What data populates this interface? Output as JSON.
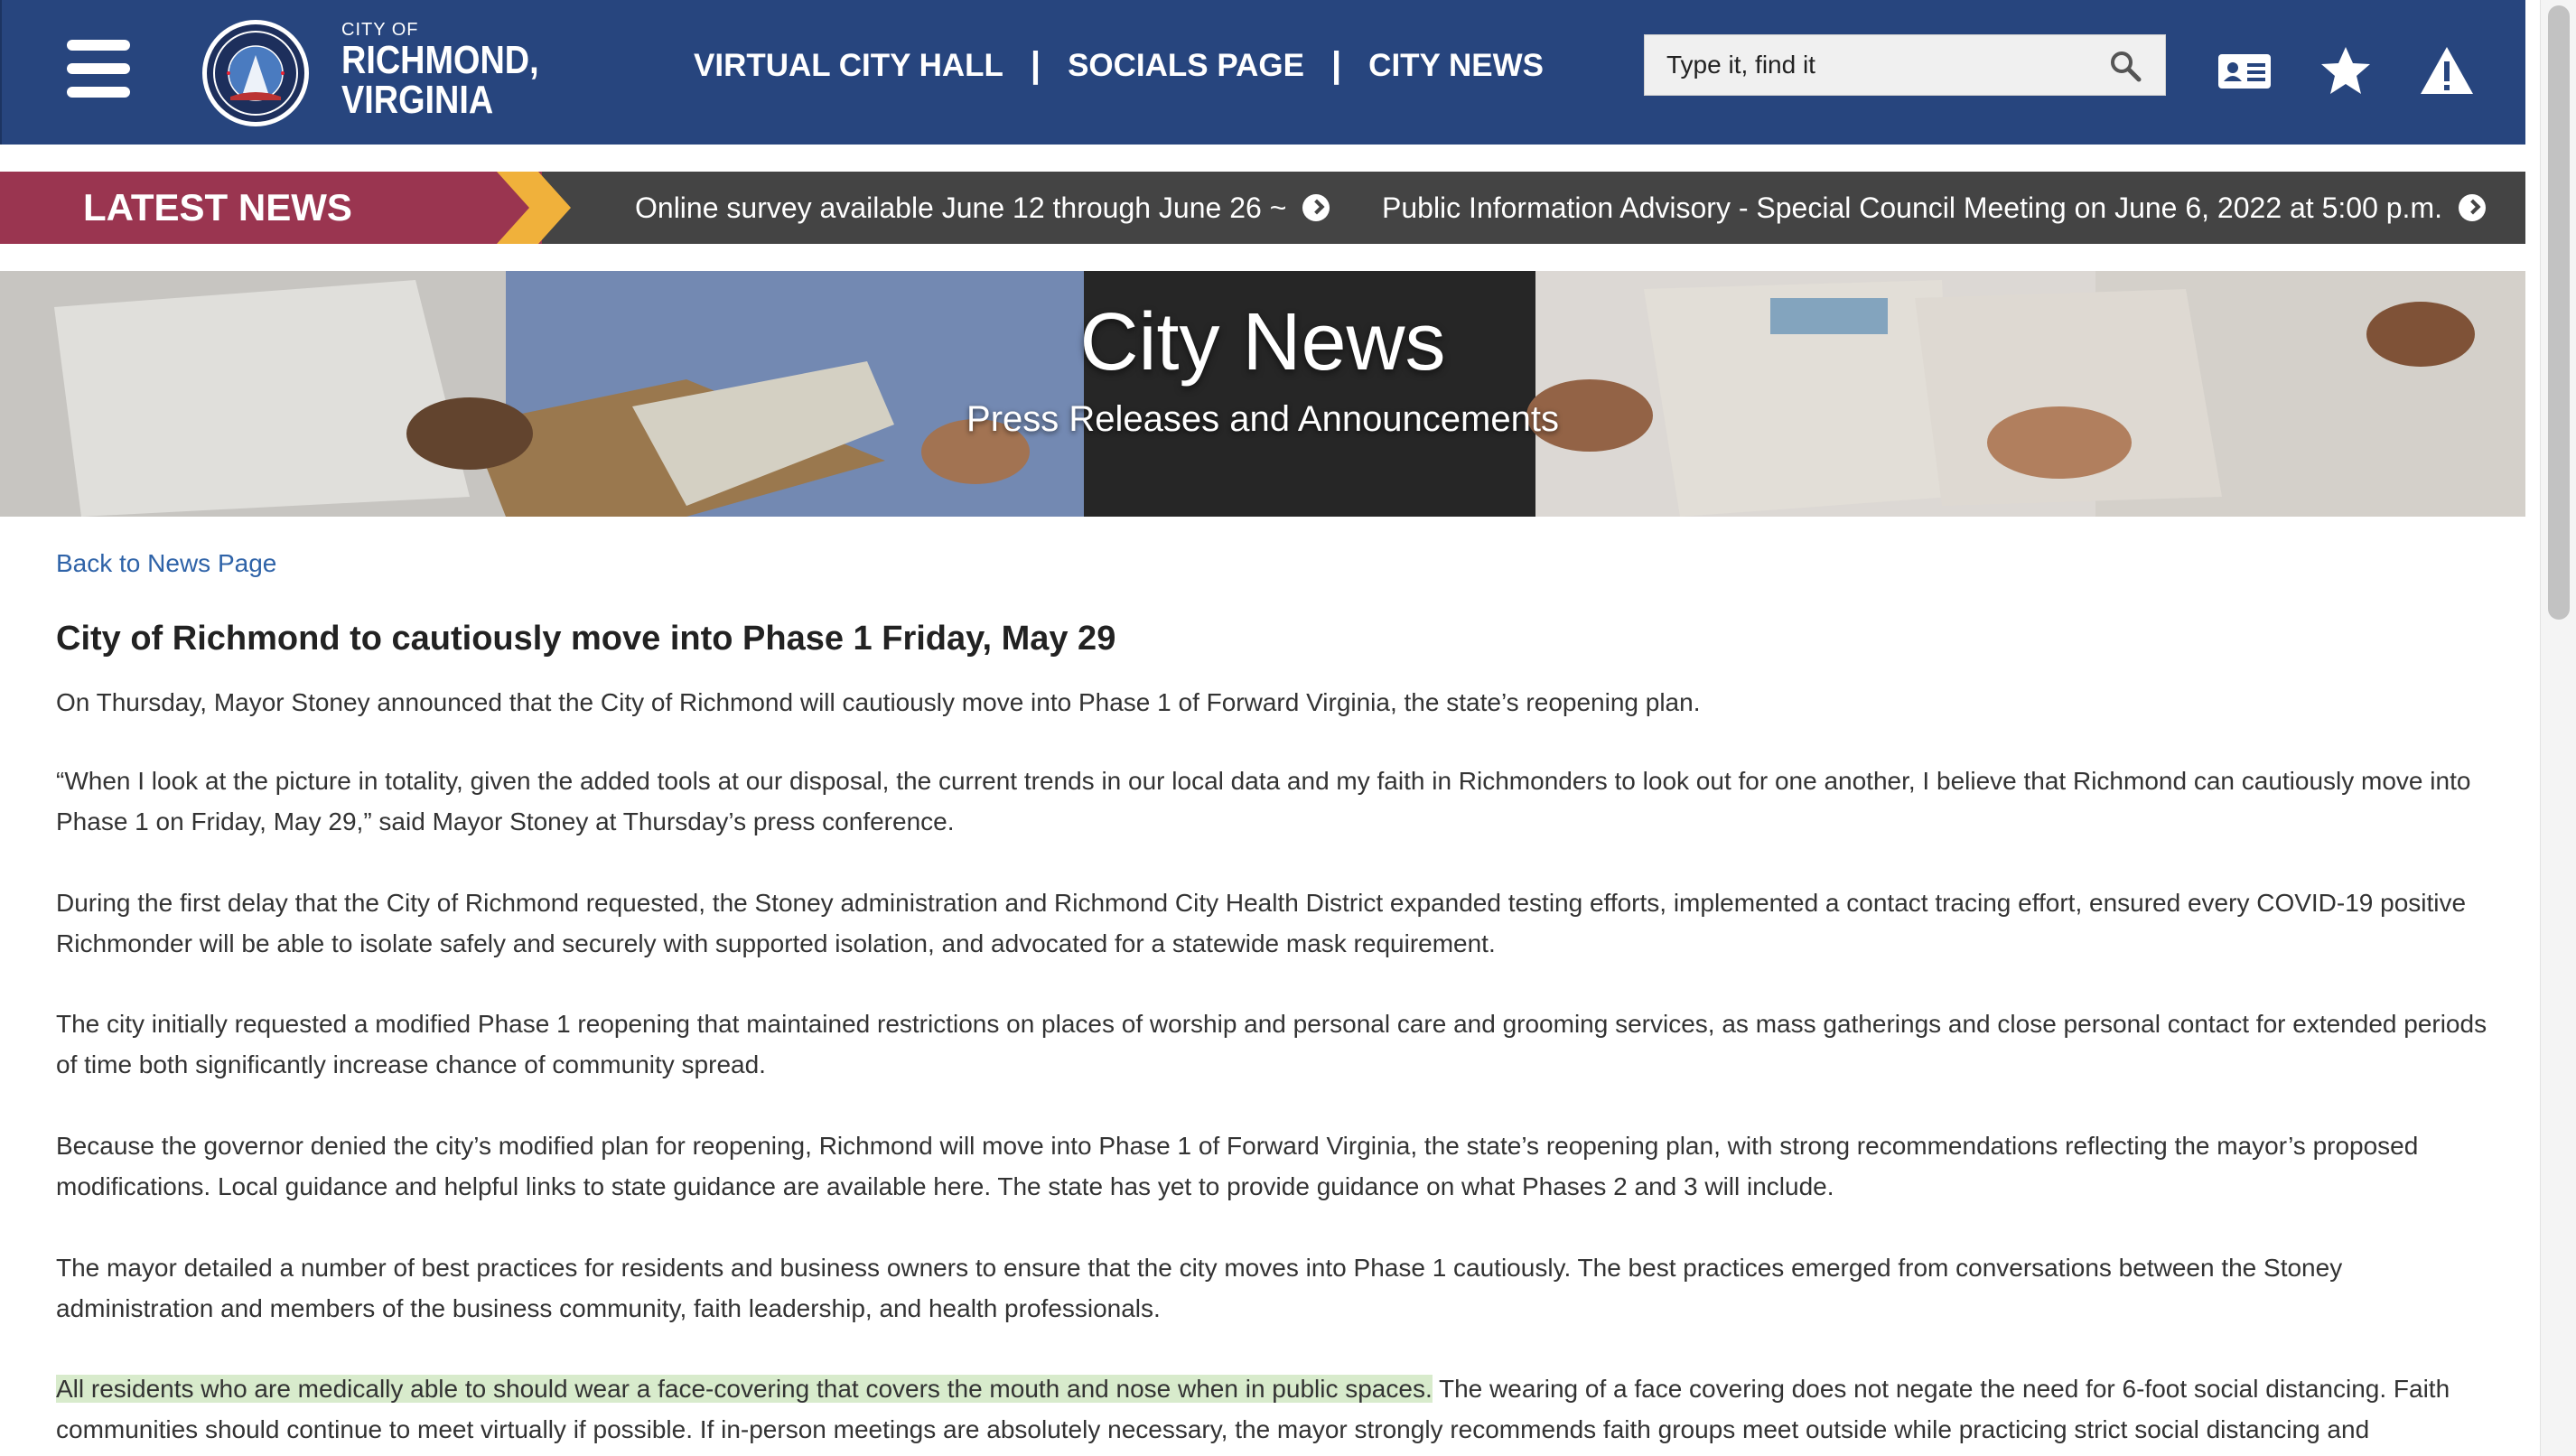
{
  "header": {
    "city_of": "CITY OF",
    "name_line1": "RICHMOND,",
    "name_line2": "VIRGINIA",
    "seal_text_top": "CITY OF RICHMOND",
    "seal_text_bottom": "ESTABLISHED 1737",
    "nav": [
      {
        "label": "VIRTUAL CITY HALL"
      },
      {
        "label": "SOCIALS PAGE"
      },
      {
        "label": "CITY NEWS"
      }
    ],
    "nav_separator": "|",
    "search_placeholder": "Type it, find it",
    "icons": [
      "menu-icon",
      "search-icon",
      "contact-card-icon",
      "star-icon",
      "alert-icon"
    ]
  },
  "latest_news": {
    "label": "LATEST NEWS",
    "items": [
      {
        "text": "Online survey available June 12 through June 26 ~"
      },
      {
        "text": "Public Information Advisory - Special Council Meeting on June 6, 2022 at 5:00 p.m."
      }
    ]
  },
  "hero": {
    "title": "City News",
    "subtitle": "Press Releases and Announcements"
  },
  "article": {
    "back_link": "Back to News Page",
    "title": "City of Richmond to cautiously move into Phase 1 Friday, May 29",
    "paragraphs": [
      "On Thursday, Mayor Stoney announced that the City of Richmond will cautiously move into Phase 1 of Forward Virginia, the state’s reopening plan.",
      "“When I look at the picture in totality, given the added tools at our disposal, the current trends in our local data and my faith in Richmonders to look out for one another, I believe that Richmond can cautiously move into Phase 1 on Friday, May 29,” said Mayor Stoney at Thursday’s press conference.",
      "During the first delay that the City of Richmond requested, the Stoney administration and Richmond City Health District expanded testing efforts, implemented a contact tracing effort, ensured every COVID-19 positive Richmonder will be able to isolate safely and securely with supported isolation, and advocated for a statewide mask requirement.",
      "The city initially requested a modified Phase 1 reopening that maintained restrictions on places of worship and personal care and grooming services, as mass gatherings and close personal contact for extended periods of time both significantly increase chance of community spread.",
      "Because the governor denied the city’s modified plan for reopening, Richmond will move into Phase 1 of Forward Virginia, the state’s reopening plan, with strong recommendations reflecting the mayor’s proposed modifications. Local guidance and helpful links to state guidance are available here. The state has yet to provide guidance on what Phases 2 and 3 will include.",
      "The mayor detailed a number of best practices for residents and business owners to ensure that the city moves into Phase 1 cautiously. The best practices emerged from conversations between the Stoney administration and members of the business community, faith leadership, and health professionals."
    ],
    "last_paragraph_highlight": "All residents who are medically able to should wear a face-covering that covers the mouth and nose when in public spaces.",
    "last_paragraph_rest": " The wearing of a face covering does not negate the need for 6-foot social distancing. Faith communities should continue to meet virtually if possible. If in-person meetings are absolutely necessary, the mayor strongly recommends faith groups meet outside while practicing strict social distancing and"
  },
  "colors": {
    "header_bg": "#27457e",
    "latest_label_bg": "#9a3550",
    "latest_arrow": "#f0b13b",
    "ticker_bg": "#444444",
    "link": "#2f63a8",
    "highlight": "#d8ebcc"
  }
}
